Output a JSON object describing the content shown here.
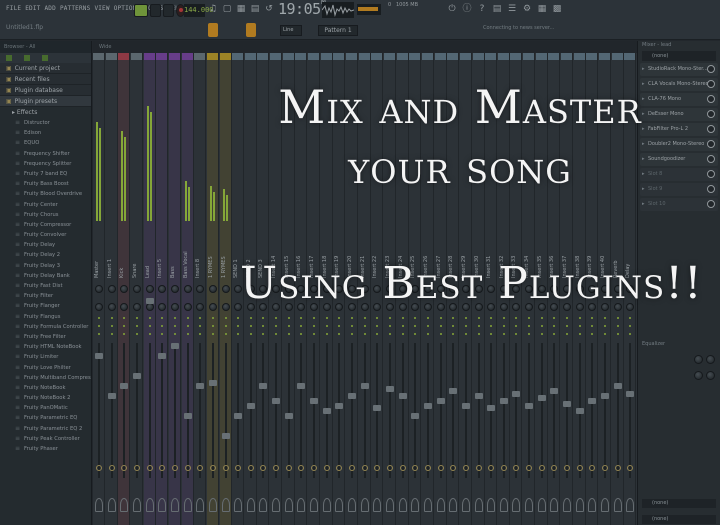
{
  "menu": [
    "FILE",
    "EDIT",
    "ADD",
    "PATTERNS",
    "VIEW",
    "OPTIONS",
    "TOOLS",
    "HELP"
  ],
  "song_name": "Untitled1.flp",
  "transport": {
    "tempo": "144.000",
    "time": "19:05",
    "time_sub": "00"
  },
  "resources": {
    "mem": "1005 MB",
    "cpu_label": "0"
  },
  "pattern": "Pattern 1",
  "snap": "Line",
  "news": "Connecting to news server...",
  "browser": {
    "filter": "Browser - All",
    "sections": [
      "Current project",
      "Recent files",
      "Plugin database",
      "Plugin presets"
    ],
    "effects_label": "Effects",
    "plugins": [
      "Distructor",
      "Edison",
      "EQUO",
      "Frequency Shifter",
      "Frequency Splitter",
      "Fruity 7 band EQ",
      "Fruity Bass Boost",
      "Fruity Blood Overdrive",
      "Fruity Center",
      "Fruity Chorus",
      "Fruity Compressor",
      "Fruity Convolver",
      "Fruity Delay",
      "Fruity Delay 2",
      "Fruity Delay 3",
      "Fruity Delay Bank",
      "Fruity Fast Dist",
      "Fruity Filter",
      "Fruity Flanger",
      "Fruity Flangus",
      "Fruity Formula Controller",
      "Fruity Free Filter",
      "Fruity HTML NoteBook",
      "Fruity Limiter",
      "Fruity Love Philter",
      "Fruity Multiband Compressor",
      "Fruity NoteBook",
      "Fruity NoteBook 2",
      "Fruity PanOMatic",
      "Fruity Parametric EQ",
      "Fruity Parametric EQ 2",
      "Fruity Peak Controller",
      "Fruity Phaser"
    ]
  },
  "mixer": {
    "label": "Wide",
    "channels": [
      {
        "name": "Master",
        "color": "#7a8a92",
        "level": 0.62
      },
      {
        "name": "Insert 1",
        "color": "#7a8a92",
        "level": 0.0
      },
      {
        "name": "Kick",
        "color": "#c04a58",
        "level": 0.56
      },
      {
        "name": "Snare",
        "color": "#7a8a92",
        "level": 0.0
      },
      {
        "name": "Lead",
        "color": "#8b4fb8",
        "level": 0.72
      },
      {
        "name": "Insert 5",
        "color": "#8b4fb8",
        "level": 0.0
      },
      {
        "name": "Bass",
        "color": "#8b4fb8",
        "level": 0.0
      },
      {
        "name": "Bass Vocal",
        "color": "#8b4fb8",
        "level": 0.25
      },
      {
        "name": "Insert 8",
        "color": "#7a8a92",
        "level": 0.0
      },
      {
        "name": "1 RYMES",
        "color": "#d4b02e",
        "level": 0.22
      },
      {
        "name": "1 RYMES",
        "color": "#d4b02e",
        "level": 0.2
      },
      {
        "name": "SEND 1",
        "color": "#6f8a9a",
        "level": 0.0
      },
      {
        "name": "SEND 2",
        "color": "#6f8a9a",
        "level": 0.0
      },
      {
        "name": "SEND 3",
        "color": "#6f8a9a",
        "level": 0.0
      },
      {
        "name": "Insert 14",
        "color": "#6f8a9a",
        "level": 0.0
      },
      {
        "name": "Insert 15",
        "color": "#6f8a9a",
        "level": 0.0
      },
      {
        "name": "Insert 16",
        "color": "#6f8a9a",
        "level": 0.0
      },
      {
        "name": "Insert 17",
        "color": "#6f8a9a",
        "level": 0.0
      },
      {
        "name": "Insert 18",
        "color": "#6f8a9a",
        "level": 0.0
      },
      {
        "name": "Insert 19",
        "color": "#6f8a9a",
        "level": 0.0
      },
      {
        "name": "Insert 20",
        "color": "#6f8a9a",
        "level": 0.0
      },
      {
        "name": "Insert 21",
        "color": "#6f8a9a",
        "level": 0.0
      },
      {
        "name": "Insert 22",
        "color": "#6f8a9a",
        "level": 0.0
      },
      {
        "name": "Insert 23",
        "color": "#6f8a9a",
        "level": 0.0
      },
      {
        "name": "Insert 24",
        "color": "#6f8a9a",
        "level": 0.0
      },
      {
        "name": "Insert 25",
        "color": "#6f8a9a",
        "level": 0.0
      },
      {
        "name": "Insert 26",
        "color": "#6f8a9a",
        "level": 0.0
      },
      {
        "name": "Insert 27",
        "color": "#6f8a9a",
        "level": 0.0
      },
      {
        "name": "Insert 28",
        "color": "#6f8a9a",
        "level": 0.0
      },
      {
        "name": "Insert 29",
        "color": "#6f8a9a",
        "level": 0.0
      },
      {
        "name": "Insert 30",
        "color": "#6f8a9a",
        "level": 0.0
      },
      {
        "name": "Insert 31",
        "color": "#6f8a9a",
        "level": 0.0
      },
      {
        "name": "Insert 32",
        "color": "#6f8a9a",
        "level": 0.0
      },
      {
        "name": "Insert 33",
        "color": "#6f8a9a",
        "level": 0.0
      },
      {
        "name": "Insert 34",
        "color": "#6f8a9a",
        "level": 0.0
      },
      {
        "name": "Insert 35",
        "color": "#6f8a9a",
        "level": 0.0
      },
      {
        "name": "Insert 36",
        "color": "#6f8a9a",
        "level": 0.0
      },
      {
        "name": "Insert 37",
        "color": "#6f8a9a",
        "level": 0.0
      },
      {
        "name": "Insert 38",
        "color": "#6f8a9a",
        "level": 0.0
      },
      {
        "name": "Insert 39",
        "color": "#6f8a9a",
        "level": 0.0
      },
      {
        "name": "Insert 40",
        "color": "#6f8a9a",
        "level": 0.0
      },
      {
        "name": "Reverb",
        "color": "#6f8a9a",
        "level": 0.0
      },
      {
        "name": "Delay",
        "color": "#6f8a9a",
        "level": 0.0
      }
    ]
  },
  "insert_panel": {
    "title": "Mixer - lead",
    "route": "(none)",
    "slots": [
      "StudioRack Mono-Ster...",
      "CLA Vocals Mono-Stereo",
      "CLA-76 Mono",
      "DeEsser Mono",
      "FabFilter Pro-L 2",
      "Doubler2 Mono-Stereo",
      "Soundgoodizer",
      "Slot 8",
      "Slot 9",
      "Slot 10"
    ],
    "slots_filled": 7,
    "eq_label": "Equalizer",
    "out1": "(none)",
    "out2": "(none)"
  },
  "headline": {
    "line1": "Mix and Master",
    "line2": "your song",
    "line3": "Using Best Plugins!!"
  },
  "colors": {
    "accent_green": "#b5e247",
    "accent_orange": "#f2a526",
    "background": "#2b3136"
  }
}
